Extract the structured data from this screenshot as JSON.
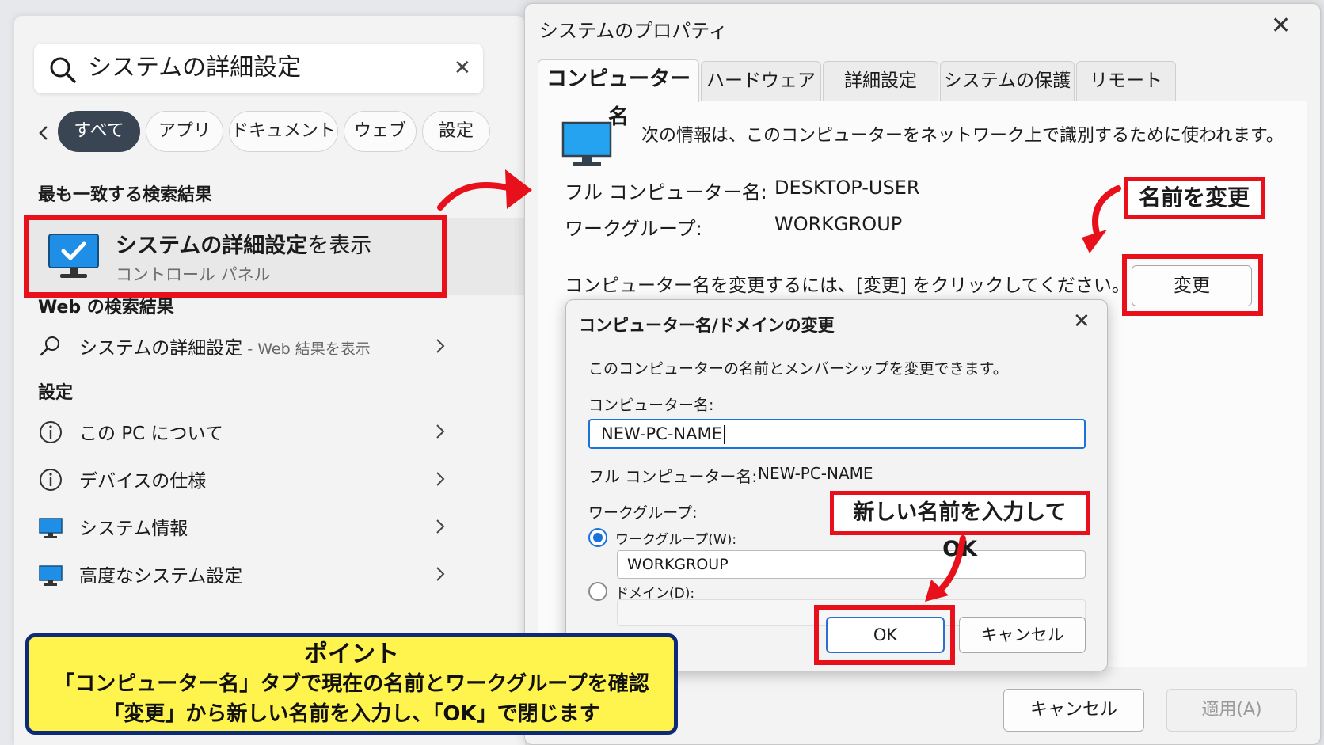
{
  "search": {
    "query": "システムの詳細設定",
    "filters": [
      "すべて",
      "アプリ",
      "ドキュメント",
      "ウェブ",
      "設定"
    ],
    "best_match_heading": "最も一致する検索結果",
    "best_match": {
      "title_bold": "システムの詳細設定",
      "title_rest": "を表示",
      "subtitle": "コントロール パネル"
    },
    "web_heading": "Web の検索結果",
    "web_result": {
      "label": "システムの詳細設定",
      "sub": " - Web 結果を表示"
    },
    "settings_heading": "設定",
    "settings_items": [
      "この PC について",
      "デバイスの仕様",
      "システム情報",
      "高度なシステム設定"
    ]
  },
  "point": {
    "title": "ポイント",
    "line1": "「コンピューター名」タブで現在の名前とワークグループを確認",
    "line2": "「変更」から新しい名前を入力し、「OK」で閉じます"
  },
  "sysprop": {
    "title": "システムのプロパティ",
    "tabs": [
      "コンピューター名",
      "ハードウェア",
      "詳細設定",
      "システムの保護",
      "リモート"
    ],
    "info": "次の情報は、このコンピューターをネットワーク上で識別するために使われます。",
    "full_name_label": "フル コンピューター名:",
    "full_name_value": "DESKTOP-USER",
    "workgroup_label": "ワークグループ:",
    "workgroup_value": "WORKGROUP",
    "change_hint": "コンピューター名を変更するには、[変更] をクリックしてください。",
    "change_button": "変更",
    "cancel_button": "キャンセル",
    "apply_button": "適用(A)"
  },
  "rename_dialog": {
    "title": "コンピューター名/ドメインの変更",
    "description": "このコンピューターの名前とメンバーシップを変更できます。",
    "name_label": "コンピューター名:",
    "name_value": "NEW-PC-NAME",
    "full_name_label": "フル コンピューター名:",
    "full_name_value": "NEW-PC-NAME",
    "member_label": "ワークグループ:",
    "workgroup_radio": "ワークグループ(W):",
    "workgroup_value": "WORKGROUP",
    "domain_radio": "ドメイン(D):",
    "ok_button": "OK",
    "cancel_button": "キャンセル"
  },
  "callouts": {
    "rename": "名前を変更",
    "new_name": "新しい名前を入力して OK"
  },
  "colors": {
    "highlight": "#e8101b",
    "accent": "#1a73d9",
    "point_bg": "#fff34d",
    "point_border": "#0d2a7a",
    "active_pill": "#3a4553"
  }
}
